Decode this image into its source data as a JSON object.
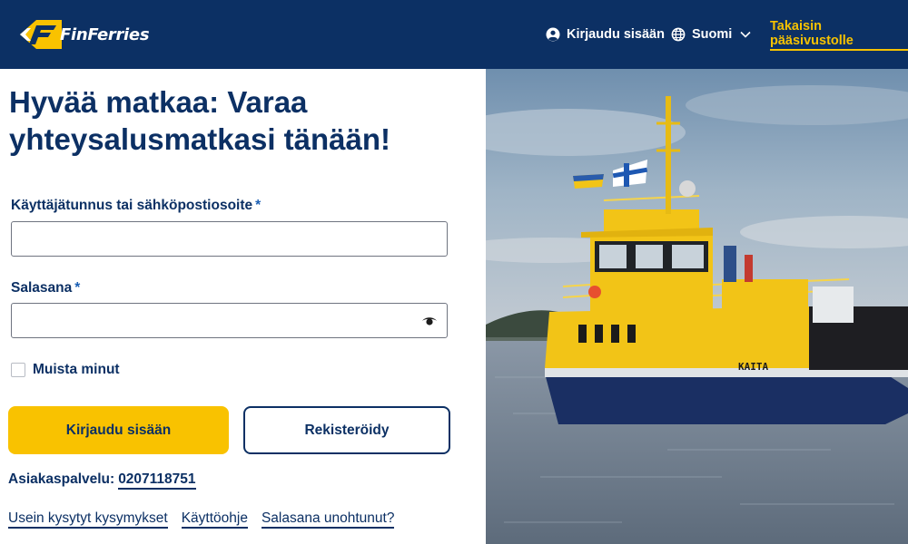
{
  "header": {
    "logo_text": "FinFerries",
    "login_label": "Kirjaudu sisään",
    "language_label": "Suomi",
    "back_label": "Takaisin pääsivustolle"
  },
  "form": {
    "title": "Hyvää matkaa: Varaa yhteysalusmatkasi tänään!",
    "username_label": "Käyttäjätunnus tai sähköpostiosoite",
    "password_label": "Salasana",
    "required_mark": "*",
    "username_value": "",
    "password_value": "",
    "remember_label": "Muista minut",
    "remember_checked": false,
    "login_button": "Kirjaudu sisään",
    "register_button": "Rekisteröidy"
  },
  "support": {
    "label": "Asiakaspalvelu:",
    "phone": "0207118751"
  },
  "footer_links": [
    "Usein kysytyt kysymykset",
    "Käyttöohje",
    "Salasana unohtunut?"
  ],
  "photo": {
    "ship_name": "KAITA"
  },
  "colors": {
    "header_bg": "#0c3064",
    "accent_yellow": "#f9c200",
    "text_navy": "#0c3064",
    "link_blue": "#1a5fb4"
  }
}
